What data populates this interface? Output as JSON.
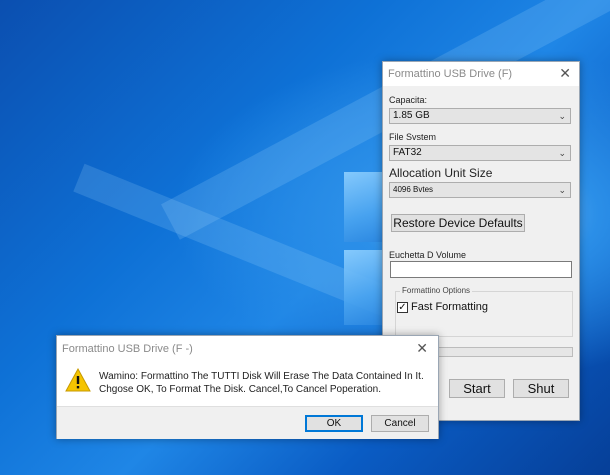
{
  "format_window": {
    "title": "Formattino USB Drive (F)",
    "close_glyph": "✕",
    "capacity_label": "Capacita:",
    "capacity_value": "1.85 GB",
    "file_system_label": "File Svstem",
    "file_system_value": "FAT32",
    "allocation_label": "Allocation Unit Size",
    "allocation_value": "4096 Bvtes",
    "restore_button": "Restore Device Defaults",
    "volume_label": "Euchetta D Volume",
    "volume_value": "",
    "options_group_label": "Formattino Options",
    "fast_format_label": "Fast Formatting",
    "fast_format_checked": "✓",
    "progress_percent": 0,
    "start_button": "Start",
    "close_button": "Shut"
  },
  "warning_dialog": {
    "title": "Formattino USB Drive (F -)",
    "close_glyph": "✕",
    "icon": "warning-icon",
    "message_line1": "Wamino: Formattino The TUTTI Disk Will Erase The Data Contained In It.",
    "message_line2": "Chgose OK, To Format The Disk. Cancel,To Cancel Poperation.",
    "ok_button": "OK",
    "cancel_button": "Cancel"
  },
  "colors": {
    "accent": "#0078d7",
    "warning_yellow": "#f5c400"
  }
}
